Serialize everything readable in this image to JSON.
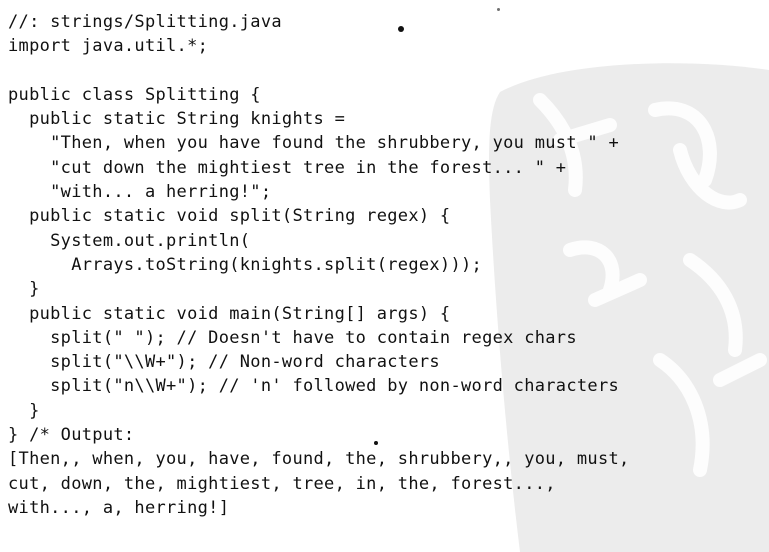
{
  "listing": {
    "lines": [
      "//: strings/Splitting.java",
      "import java.util.*;",
      "",
      "public class Splitting {",
      "  public static String knights =",
      "    \"Then, when you have found the shrubbery, you must \" +",
      "    \"cut down the mightiest tree in the forest... \" +",
      "    \"with... a herring!\";",
      "  public static void split(String regex) {",
      "    System.out.println(",
      "      Arrays.toString(knights.split(regex)));",
      "  }",
      "  public static void main(String[] args) {",
      "    split(\" \"); // Doesn't have to contain regex chars",
      "    split(\"\\\\W+\"); // Non-word characters",
      "    split(\"n\\\\W+\"); // 'n' followed by non-word characters",
      "  }",
      "} /* Output:",
      "[Then,, when, you, have, found, the, shrubbery,, you, must,",
      "cut, down, the, mightiest, tree, in, the, forest...,",
      "with..., a, herring!]"
    ]
  },
  "colors": {
    "text": "#111111",
    "watermark": "#ebebeb",
    "watermark_glyphs": "#ffffff"
  },
  "icons": {
    "watermark": "seal-watermark"
  }
}
